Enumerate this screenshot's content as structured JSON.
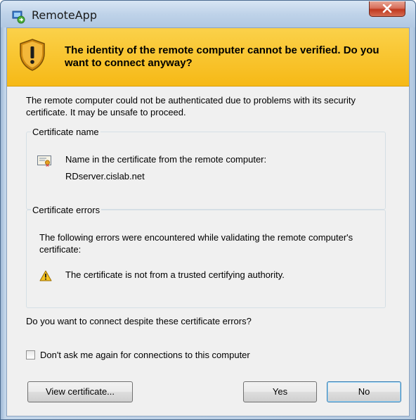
{
  "window": {
    "title": "RemoteApp"
  },
  "banner": {
    "message": "The identity of the remote computer cannot be verified. Do you want to connect anyway?"
  },
  "intro": "The remote computer could not be authenticated due to problems with its security certificate. It may be unsafe to proceed.",
  "certificate_name": {
    "legend": "Certificate name",
    "label": "Name in the certificate from the remote computer:",
    "value": "RDserver.cislab.net"
  },
  "certificate_errors": {
    "legend": "Certificate errors",
    "intro": "The following errors were encountered while validating the remote computer's certificate:",
    "items": [
      "The certificate is not from a trusted certifying authority."
    ]
  },
  "question": "Do you want to connect despite these certificate errors?",
  "checkbox": {
    "label": "Don't ask me again for connections to this computer",
    "checked": false
  },
  "buttons": {
    "view_certificate": "View certificate...",
    "yes": "Yes",
    "no": "No"
  },
  "colors": {
    "banner": "#f6b916",
    "close_button": "#c0391f",
    "default_button_border": "#3c7fb1"
  },
  "icons": {
    "app": "remoteapp-icon",
    "banner": "shield-warning-icon",
    "certificate": "certificate-icon",
    "error": "warning-triangle-icon",
    "close": "close-icon"
  }
}
